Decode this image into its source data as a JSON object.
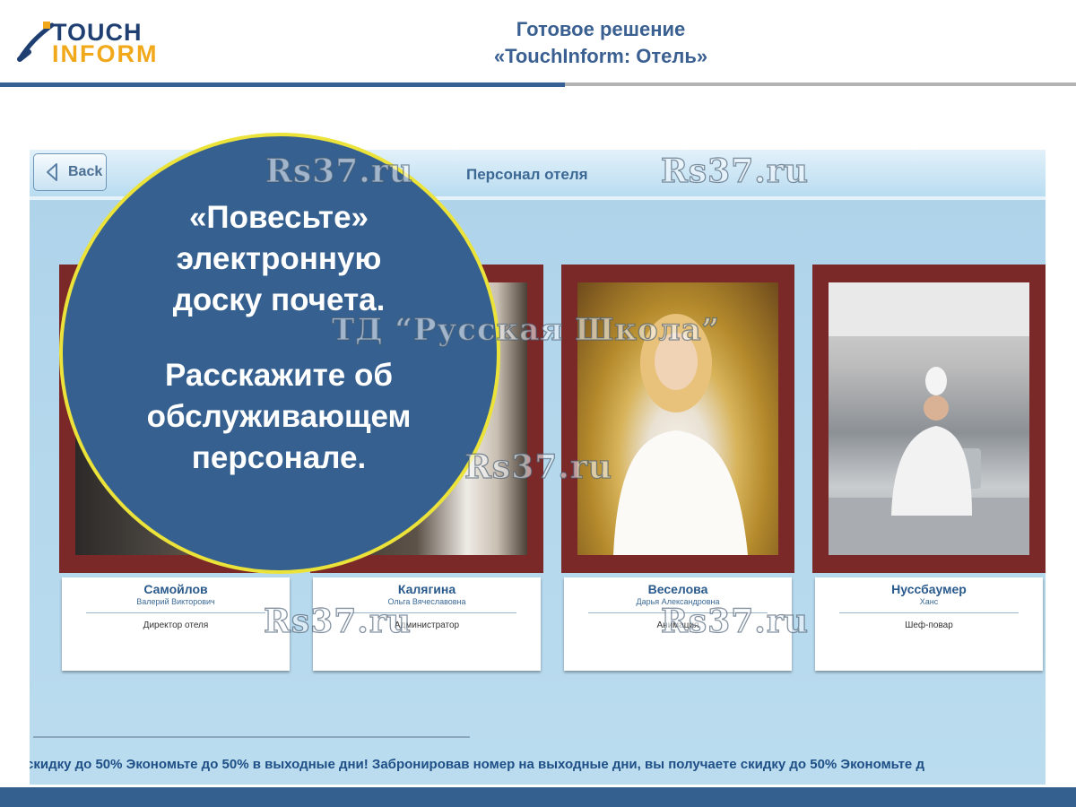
{
  "logo": {
    "line1": "TOUCH",
    "line2": "INFORM"
  },
  "slide": {
    "title_line1": "Готовое решение",
    "title_line2": "«TouchInform: Отель»"
  },
  "app": {
    "back_label": "Back",
    "screen_title": "Персонал отеля",
    "staff": [
      {
        "surname": "Самойлов",
        "given": "Валерий Викторович",
        "role": "Директор отеля"
      },
      {
        "surname": "Калягина",
        "given": "Ольга Вячеславовна",
        "role": "Администратор"
      },
      {
        "surname": "Веселова",
        "given": "Дарья Александровна",
        "role": "Анимация"
      },
      {
        "surname": "Нуссбаумер",
        "given": "Ханс",
        "role": "Шеф-повар"
      }
    ],
    "ticker": "скидку до 50%   Экономьте до 50% в выходные дни! Забронировав номер на выходные дни, вы получаете скидку до 50%   Экономьте д"
  },
  "callout": {
    "line1": "«Повесьте»",
    "line2": "электронную",
    "line3": "доску почета.",
    "line4": "Расскажите об",
    "line5": "обслуживающем",
    "line6": "персонале."
  },
  "watermarks": {
    "site": "Rs37.ru",
    "company": "ТД “Русская Школа”"
  },
  "colors": {
    "accent_blue": "#365f94",
    "callout_border": "#ece33a",
    "frame_red": "#7a2828",
    "logo_orange": "#f1a81a"
  }
}
